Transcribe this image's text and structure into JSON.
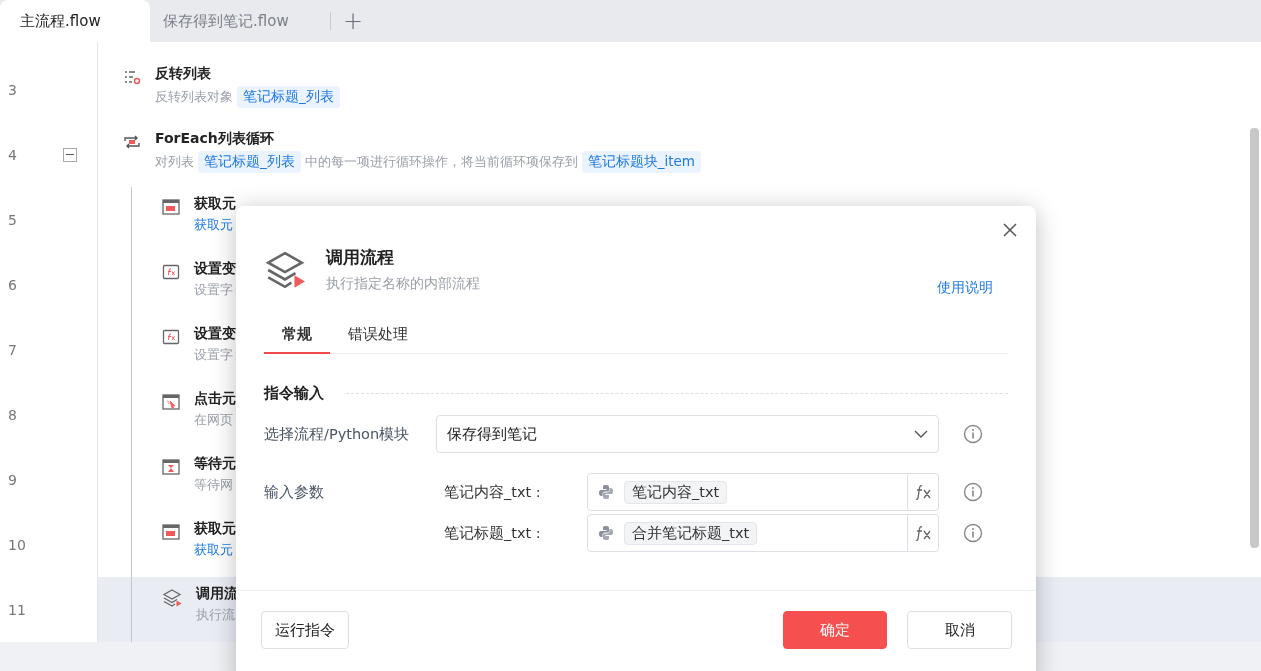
{
  "tabs": [
    {
      "label": "主流程.flow",
      "selected": true
    },
    {
      "label": "保存得到笔记.flow",
      "selected": false
    }
  ],
  "add_tab": "+",
  "steps": [
    {
      "line": "3",
      "kind": "list",
      "title": "反转列表",
      "selected": false,
      "desc": [
        {
          "kind": "text",
          "text": "反转列表对象"
        },
        {
          "kind": "var",
          "text": "笔记标题_列表"
        }
      ]
    },
    {
      "line": "4",
      "kind": "loop",
      "title": "ForEach列表循环",
      "selected": false,
      "expanded": true,
      "desc": [
        {
          "kind": "text",
          "text": "对列表"
        },
        {
          "kind": "var",
          "text": "笔记标题_列表"
        },
        {
          "kind": "text",
          "text": "中的每一项进行循环操作，将当前循环项保存到"
        },
        {
          "kind": "var",
          "text": "笔记标题块_item"
        }
      ],
      "children": [
        {
          "line": "5",
          "kind": "web",
          "title": "获取元",
          "selected": false,
          "desc": [
            {
              "kind": "link",
              "text": "获取元"
            }
          ]
        },
        {
          "line": "6",
          "kind": "fx",
          "title": "设置变",
          "selected": false,
          "desc": [
            {
              "kind": "text",
              "text": "设置字"
            }
          ]
        },
        {
          "line": "7",
          "kind": "fx",
          "title": "设置变",
          "selected": false,
          "desc": [
            {
              "kind": "text",
              "text": "设置字"
            }
          ]
        },
        {
          "line": "8",
          "kind": "click",
          "title": "点击元",
          "selected": false,
          "desc": [
            {
              "kind": "text",
              "text": "在网页"
            }
          ]
        },
        {
          "line": "9",
          "kind": "wait",
          "title": "等待元",
          "selected": false,
          "desc": [
            {
              "kind": "text",
              "text": "等待网"
            }
          ]
        },
        {
          "line": "10",
          "kind": "web",
          "title": "获取元",
          "selected": false,
          "desc": [
            {
              "kind": "link",
              "text": "获取元"
            }
          ]
        },
        {
          "line": "11",
          "kind": "layers",
          "title": "调用流",
          "selected": true,
          "desc": [
            {
              "kind": "text",
              "text": "执行流"
            }
          ]
        }
      ]
    }
  ],
  "dialog": {
    "title": "调用流程",
    "subtitle": "执行指定名称的内部流程",
    "help_link": "使用说明",
    "tabs": [
      {
        "label": "常规",
        "selected": true
      },
      {
        "label": "错误处理",
        "selected": false
      }
    ],
    "section": "指令输入",
    "flow_select": {
      "label": "选择流程/Python模块",
      "value": "保存得到笔记"
    },
    "params_label": "输入参数",
    "params": [
      {
        "name": "笔记内容_txt :",
        "value": "笔记内容_txt"
      },
      {
        "name": "笔记标题_txt :",
        "value": "合并笔记标题_txt"
      }
    ],
    "buttons": {
      "run": "运行指令",
      "ok": "确定",
      "cancel": "取消"
    }
  }
}
